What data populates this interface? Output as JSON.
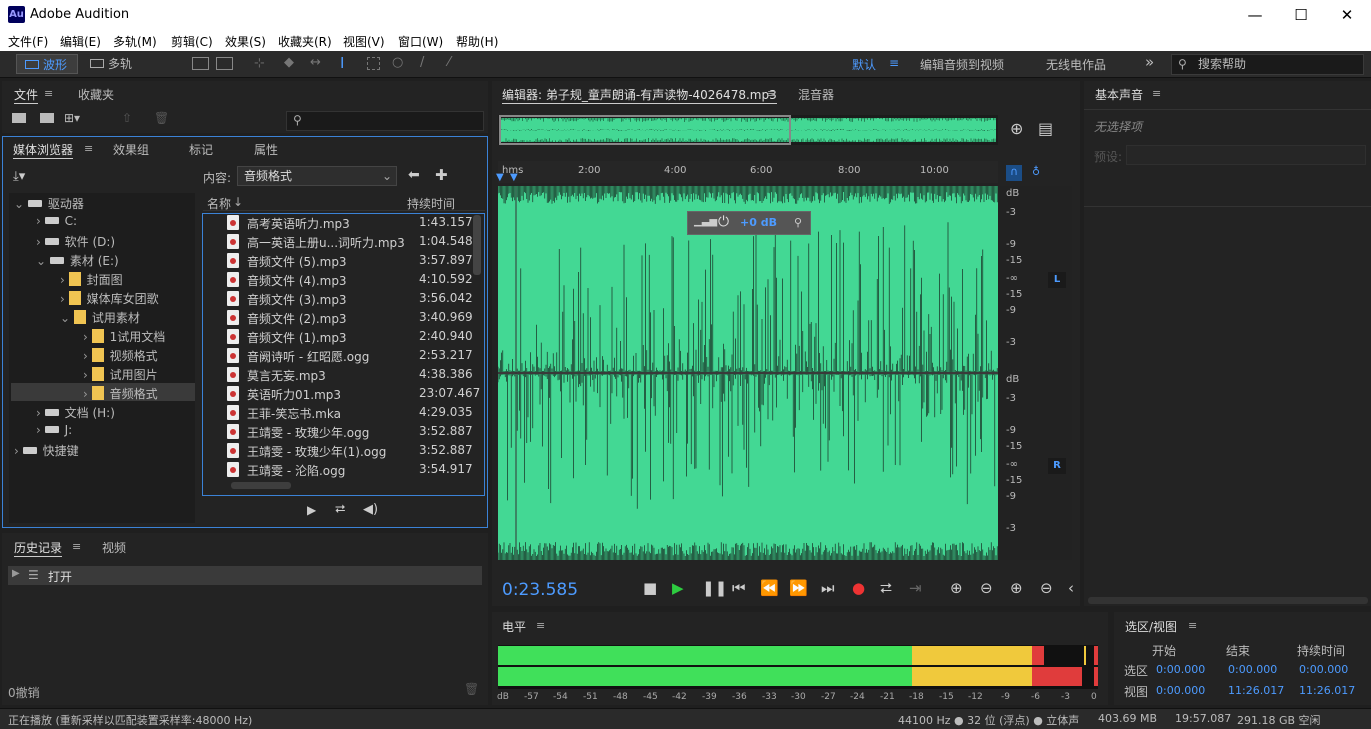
{
  "window": {
    "app_icon": "Au",
    "title": "Adobe Audition",
    "min": "—",
    "max": "☐",
    "close": "✕"
  },
  "menu": [
    "文件(F)",
    "编辑(E)",
    "多轨(M)",
    "剪辑(C)",
    "效果(S)",
    "收藏夹(R)",
    "视图(V)",
    "窗口(W)",
    "帮助(H)"
  ],
  "toolbar": {
    "waveform": "波形",
    "multitrack": "多轨",
    "workspaces": [
      "默认",
      "编辑音频到视频",
      "无线电作品"
    ],
    "more": "»",
    "search_placeholder": "搜索帮助"
  },
  "files_panel": {
    "tabs": [
      "文件",
      "收藏夹"
    ]
  },
  "media_browser": {
    "tabs": [
      "媒体浏览器",
      "效果组",
      "标记",
      "属性"
    ],
    "content_label": "内容:",
    "content_value": "音频格式",
    "tree": [
      {
        "label": "驱动器",
        "kind": "root"
      },
      {
        "label": "C:",
        "kind": "drive"
      },
      {
        "label": "软件 (D:)",
        "kind": "drive"
      },
      {
        "label": "素材 (E:)",
        "kind": "drive"
      },
      {
        "label": "封面图",
        "kind": "folder"
      },
      {
        "label": "媒体库女团歌",
        "kind": "folder"
      },
      {
        "label": "试用素材",
        "kind": "folder"
      },
      {
        "label": "1试用文档",
        "kind": "folder"
      },
      {
        "label": "视频格式",
        "kind": "folder"
      },
      {
        "label": "试用图片",
        "kind": "folder"
      },
      {
        "label": "音频格式",
        "kind": "folder"
      },
      {
        "label": "文档 (H:)",
        "kind": "drive"
      },
      {
        "label": "J:",
        "kind": "drive"
      },
      {
        "label": "快捷键",
        "kind": "root"
      }
    ],
    "columns": {
      "name": "名称",
      "duration": "持续时间"
    },
    "files": [
      {
        "name": "高考英语听力.mp3",
        "dur": "1:43.157"
      },
      {
        "name": "高一英语上册u...词听力.mp3",
        "dur": "1:04.548"
      },
      {
        "name": "音频文件 (5).mp3",
        "dur": "3:57.897"
      },
      {
        "name": "音频文件 (4).mp3",
        "dur": "4:10.592"
      },
      {
        "name": "音频文件 (3).mp3",
        "dur": "3:56.042"
      },
      {
        "name": "音频文件 (2).mp3",
        "dur": "3:40.969"
      },
      {
        "name": "音频文件 (1).mp3",
        "dur": "2:40.940"
      },
      {
        "name": "音阙诗听 - 红昭愿.ogg",
        "dur": "2:53.217"
      },
      {
        "name": "莫言无妄.mp3",
        "dur": "4:38.386"
      },
      {
        "name": "英语听力01.mp3",
        "dur": "23:07.467"
      },
      {
        "name": "王菲-笑忘书.mka",
        "dur": "4:29.035"
      },
      {
        "name": "王靖雯 - 玫瑰少年.ogg",
        "dur": "3:52.887"
      },
      {
        "name": "王靖雯 - 玫瑰少年(1).ogg",
        "dur": "3:52.887"
      },
      {
        "name": "王靖雯 - 沦陷.ogg",
        "dur": "3:54.917"
      }
    ]
  },
  "history": {
    "tabs": [
      "历史记录",
      "视频"
    ],
    "item": "打开",
    "undo_count": "0撤销"
  },
  "editor": {
    "tab": "编辑器: 弟子规_童声朗诵-有声读物-4026478.mp3",
    "mixer": "混音器",
    "time_unit": "hms",
    "ruler": [
      "2:00",
      "4:00",
      "6:00",
      "8:00",
      "10:00"
    ],
    "gain": "+0 dB",
    "db_scale": [
      "dB",
      "-3",
      "-9",
      "-15",
      "-∞",
      "-15",
      "-9",
      "-3"
    ],
    "channels": [
      "L",
      "R"
    ],
    "current_time": "0:23.585",
    "waveform_color": "#43d894"
  },
  "essential_sound": {
    "title": "基本声音",
    "none": "无选择项",
    "preset": "预设:"
  },
  "levels": {
    "title": "电平",
    "scale": [
      "dB",
      "-57",
      "-54",
      "-51",
      "-48",
      "-45",
      "-42",
      "-39",
      "-36",
      "-33",
      "-30",
      "-27",
      "-24",
      "-21",
      "-18",
      "-15",
      "-12",
      "-9",
      "-6",
      "-3",
      "0"
    ]
  },
  "selection": {
    "title": "选区/视图",
    "cols": [
      "开始",
      "结束",
      "持续时间"
    ],
    "rows": [
      {
        "label": "选区",
        "start": "0:00.000",
        "end": "0:00.000",
        "dur": "0:00.000"
      },
      {
        "label": "视图",
        "start": "0:00.000",
        "end": "11:26.017",
        "dur": "11:26.017"
      }
    ]
  },
  "status": {
    "left": "正在播放 (重新采样以匹配装置采样率:48000 Hz)",
    "rate": "44100 Hz ● 32 位 (浮点) ● 立体声",
    "size": "403.69 MB",
    "dur": "19:57.087",
    "free": "291.18 GB 空闲"
  }
}
